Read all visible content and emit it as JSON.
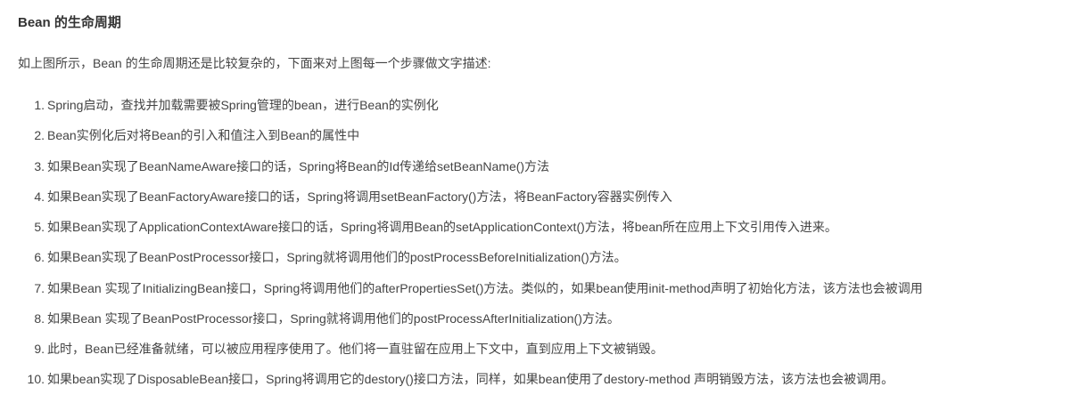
{
  "article": {
    "heading": "Bean 的生命周期",
    "intro": "如上图所示，Bean 的生命周期还是比较复杂的，下面来对上图每一个步骤做文字描述:",
    "steps": [
      {
        "num": "1.",
        "text": "Spring启动，查找并加载需要被Spring管理的bean，进行Bean的实例化"
      },
      {
        "num": "2.",
        "text": "Bean实例化后对将Bean的引入和值注入到Bean的属性中"
      },
      {
        "num": "3.",
        "text": "如果Bean实现了BeanNameAware接口的话，Spring将Bean的Id传递给setBeanName()方法"
      },
      {
        "num": "4.",
        "text": "如果Bean实现了BeanFactoryAware接口的话，Spring将调用setBeanFactory()方法，将BeanFactory容器实例传入"
      },
      {
        "num": "5.",
        "text": "如果Bean实现了ApplicationContextAware接口的话，Spring将调用Bean的setApplicationContext()方法，将bean所在应用上下文引用传入进来。"
      },
      {
        "num": "6.",
        "text": "如果Bean实现了BeanPostProcessor接口，Spring就将调用他们的postProcessBeforeInitialization()方法。"
      },
      {
        "num": "7.",
        "text": "如果Bean 实现了InitializingBean接口，Spring将调用他们的afterPropertiesSet()方法。类似的，如果bean使用init-method声明了初始化方法，该方法也会被调用"
      },
      {
        "num": "8.",
        "text": "如果Bean 实现了BeanPostProcessor接口，Spring就将调用他们的postProcessAfterInitialization()方法。"
      },
      {
        "num": "9.",
        "text": "此时，Bean已经准备就绪，可以被应用程序使用了。他们将一直驻留在应用上下文中，直到应用上下文被销毁。"
      },
      {
        "num": "10.",
        "text": "如果bean实现了DisposableBean接口，Spring将调用它的destory()接口方法，同样，如果bean使用了destory-method 声明销毁方法，该方法也会被调用。"
      }
    ]
  }
}
